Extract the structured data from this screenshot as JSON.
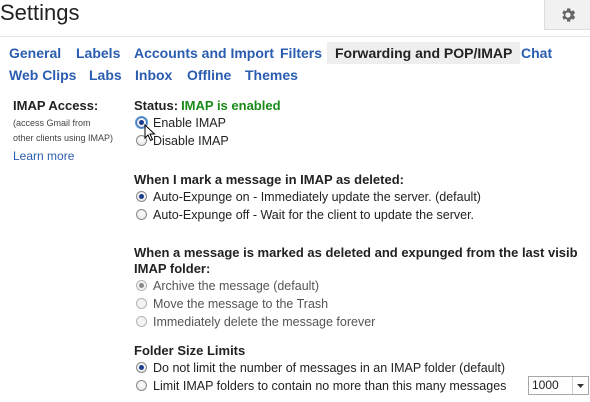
{
  "header": {
    "title": "Settings"
  },
  "tabs": {
    "row1": [
      "General",
      "Labels",
      "Accounts and Import",
      "Filters",
      "Forwarding and POP/IMAP",
      "Chat"
    ],
    "row2": [
      "Web Clips",
      "Labs",
      "Inbox",
      "Offline",
      "Themes"
    ],
    "active": "Forwarding and POP/IMAP"
  },
  "imap": {
    "title": "IMAP Access:",
    "sub1": "(access Gmail from",
    "sub2": "other clients using IMAP)",
    "learn_more": "Learn more",
    "status_label": "Status:",
    "status_value": "IMAP is enabled",
    "enable": "Enable IMAP",
    "disable": "Disable IMAP"
  },
  "deleted": {
    "title": "When I mark a message in IMAP as deleted:",
    "opt1": "Auto-Expunge on - Immediately update the server. (default)",
    "opt2": "Auto-Expunge off - Wait for the client to update the server."
  },
  "expunged": {
    "title_line1": "When a message is marked as deleted and expunged from the last visib",
    "title_line2": "IMAP folder:",
    "opt1": "Archive the message (default)",
    "opt2": "Move the message to the Trash",
    "opt3": "Immediately delete the message forever"
  },
  "folder": {
    "title": "Folder Size Limits",
    "opt1": "Do not limit the number of messages in an IMAP folder (default)",
    "opt2": "Limit IMAP folders to contain no more than this many messages",
    "limit_value": "1000"
  },
  "colors": {
    "link": "#2a5db0",
    "status_green": "#1a8a1a",
    "active_tab_bg": "#eeeeee"
  }
}
